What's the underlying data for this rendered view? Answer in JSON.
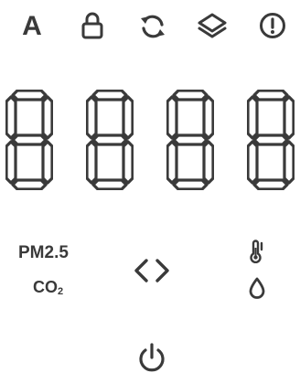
{
  "toolbar": {
    "auto_label": "A",
    "icons": [
      "lock-icon",
      "refresh-icon",
      "layers-icon",
      "alert-icon"
    ]
  },
  "display": {
    "digits": [
      "8",
      "8",
      "8",
      "8"
    ],
    "segment_color": "#3a3a3a"
  },
  "modes": {
    "pm25_label": "PM2.5",
    "co2_label": "CO",
    "co2_subscript": "2",
    "toggle_icon": "left-right-chevrons-icon",
    "right_icons": [
      "thermometer-icon",
      "water-drop-icon"
    ]
  },
  "power": {
    "icon": "power-icon"
  },
  "colors": {
    "foreground": "#3a3a3a",
    "background": "#ffffff"
  }
}
